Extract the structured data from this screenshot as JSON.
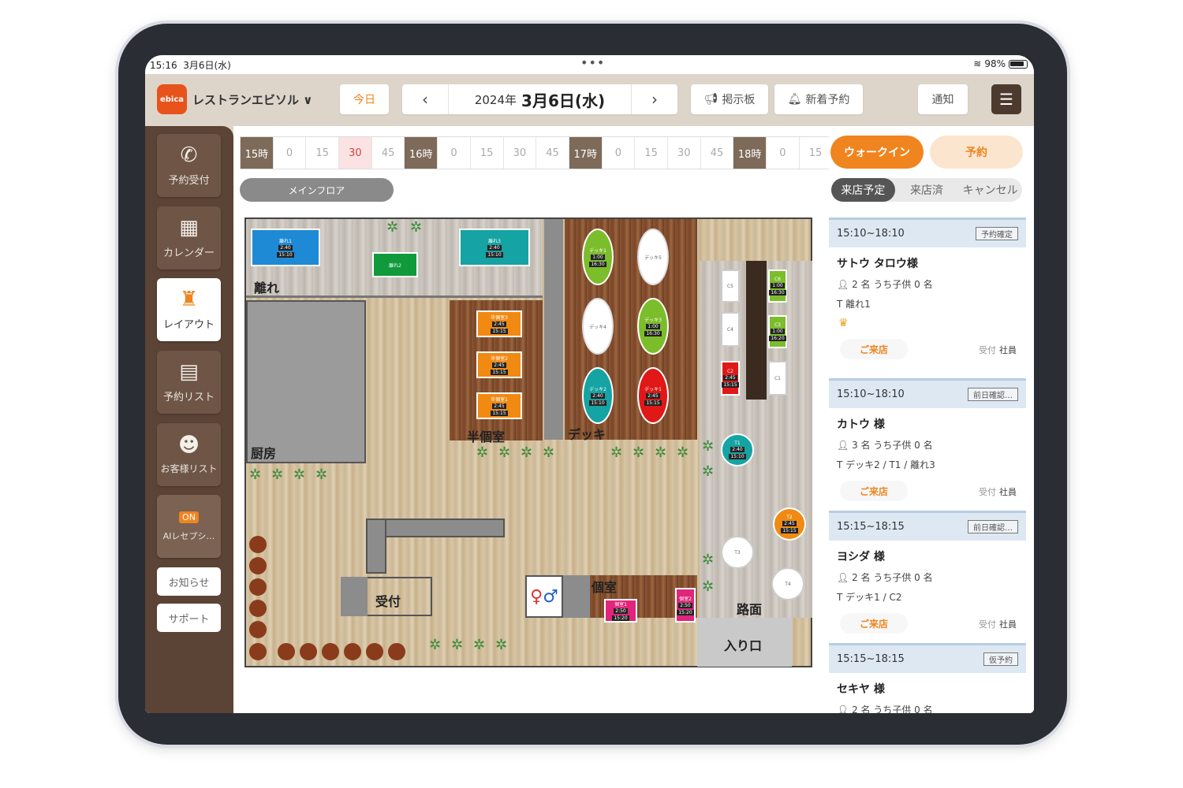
{
  "status": {
    "time": "15:16",
    "date": "3月6日(水)",
    "battery": "98%",
    "dots": "•••"
  },
  "header": {
    "logo": "ebica",
    "shop_name": "レストランエビソル ∨",
    "today_label": "今日",
    "date_year": "2024年",
    "date_day": "3月6日(水)",
    "prev_icon": "chevron-left-icon",
    "next_icon": "chevron-right-icon",
    "board_label": "掲示板",
    "new_reservation_label": "新着予約",
    "notify_label": "通知",
    "menu_icon": "hamburger-menu-icon"
  },
  "sidebar": {
    "items": [
      {
        "label": "予約受付",
        "icon": "phone-icon",
        "glyph": "✆"
      },
      {
        "label": "カレンダー",
        "icon": "calendar-icon",
        "glyph": "▦"
      },
      {
        "label": "レイアウト",
        "icon": "table-layout-icon",
        "glyph": "♜"
      },
      {
        "label": "予約リスト",
        "icon": "book-icon",
        "glyph": "▤"
      },
      {
        "label": "お客様リスト",
        "icon": "customers-icon",
        "glyph": "☻"
      },
      {
        "label": "AIレセプシ…",
        "icon": "ai-receptionist-icon",
        "glyph": "ON"
      }
    ],
    "news_label": "お知らせ",
    "support_label": "サポート"
  },
  "timeline": [
    "15時",
    "0",
    "15",
    "30",
    "45",
    "16時",
    "0",
    "15",
    "30",
    "45",
    "17時",
    "0",
    "15",
    "30",
    "45",
    "18時",
    "0",
    "15"
  ],
  "floor_label": "メインフロア",
  "plan_labels": {
    "hanare": "離れ",
    "kitchen": "厨房",
    "semi_private": "半個室",
    "deck": "デッキ",
    "reception": "受付",
    "private_room": "個室",
    "street": "路面",
    "entrance": "入り口"
  },
  "tables": [
    {
      "name": "離れ1",
      "t": "2:40",
      "e": "15:10"
    },
    {
      "name": "離れ2",
      "t": "",
      "e": ""
    },
    {
      "name": "離れ3",
      "t": "2:40",
      "e": "15:10"
    },
    {
      "name": "半個室3",
      "t": "2:45",
      "e": "15:15"
    },
    {
      "name": "半個室2",
      "t": "2:45",
      "e": "15:15"
    },
    {
      "name": "半個室1",
      "t": "2:45",
      "e": "15:15"
    },
    {
      "name": "デッキ1",
      "t": "1:00",
      "e": "16:30"
    },
    {
      "name": "デッキ5",
      "t": "",
      "e": ""
    },
    {
      "name": "デッキ4",
      "t": "",
      "e": ""
    },
    {
      "name": "デッキ3",
      "t": "1:00",
      "e": "16:30"
    },
    {
      "name": "デッキ2",
      "t": "2:40",
      "e": "15:10"
    },
    {
      "name": "デッキ1",
      "t": "2:45",
      "e": "15:15"
    },
    {
      "name": "C5",
      "t": "",
      "e": ""
    },
    {
      "name": "C4",
      "t": "",
      "e": ""
    },
    {
      "name": "C2",
      "t": "2:45",
      "e": "15:15"
    },
    {
      "name": "C1",
      "t": "",
      "e": ""
    },
    {
      "name": "C6",
      "t": "1:00",
      "e": "16:30"
    },
    {
      "name": "C3",
      "t": "1:00",
      "e": "16:20"
    },
    {
      "name": "T1",
      "t": "2:40",
      "e": "15:10"
    },
    {
      "name": "T2",
      "t": "2:45",
      "e": "15:15"
    },
    {
      "name": "T3",
      "t": "",
      "e": ""
    },
    {
      "name": "T4",
      "t": "",
      "e": ""
    },
    {
      "name": "個室1",
      "t": "2:50",
      "e": "15:20"
    },
    {
      "name": "個室2",
      "t": "2:50",
      "e": "15:20"
    }
  ],
  "right_panel": {
    "walkin_label": "ウォークイン",
    "reserve_label": "予約",
    "tabs": [
      "来店予定",
      "来店済",
      "キャンセル"
    ],
    "arrive_label": "ご来店",
    "received_label": "受付",
    "staff_label": "社員",
    "reservations": [
      {
        "time": "15:10~18:10",
        "status": "予約確定",
        "name": "サトウ タロウ様",
        "people": "2 名 うち子供 0 名",
        "tables": "離れ1",
        "vip": true
      },
      {
        "time": "15:10~18:10",
        "status": "前日確認…",
        "name": "カトウ 様",
        "people": "3 名 うち子供 0 名",
        "tables": "デッキ2 / T1 / 離れ3",
        "vip": false
      },
      {
        "time": "15:15~18:15",
        "status": "前日確認…",
        "name": "ヨシダ 様",
        "people": "2 名 うち子供 0 名",
        "tables": "デッキ1 / C2",
        "vip": false
      },
      {
        "time": "15:15~18:15",
        "status": "仮予約",
        "name": "セキヤ 様",
        "people": "2 名 うち子供 0 名",
        "tables": "",
        "vip": false
      }
    ]
  },
  "colors": {
    "accent": "#f0841f",
    "sidebar": "#5b4335",
    "header": "#ddd5ca"
  }
}
